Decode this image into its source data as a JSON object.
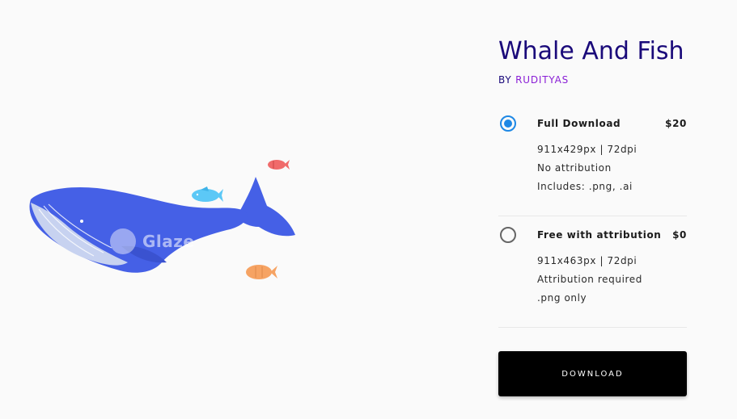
{
  "product": {
    "title": "Whale And Fish",
    "by_prefix": "BY",
    "author": "RUDITYAS"
  },
  "illustration": {
    "watermark": "Glaze",
    "colors": {
      "whale_body": "#4560e6",
      "whale_belly": "#c7d2f0",
      "fish_cyan": "#5cc8f6",
      "fish_red": "#f06b6b",
      "fish_orange": "#f6a363"
    }
  },
  "options": [
    {
      "name": "Full Download",
      "price": "$20",
      "selected": true,
      "details": [
        "911x429px | 72dpi",
        "No attribution",
        "Includes: .png, .ai"
      ]
    },
    {
      "name": "Free with attribution",
      "price": "$0",
      "selected": false,
      "details": [
        "911x463px | 72dpi",
        "Attribution required",
        ".png only"
      ]
    }
  ],
  "download_label": "DOWNLOAD",
  "colors": {
    "title": "#1a0a7a",
    "author": "#8a1fd6",
    "radio_accent": "#1e88e5",
    "button_bg": "#000000"
  }
}
